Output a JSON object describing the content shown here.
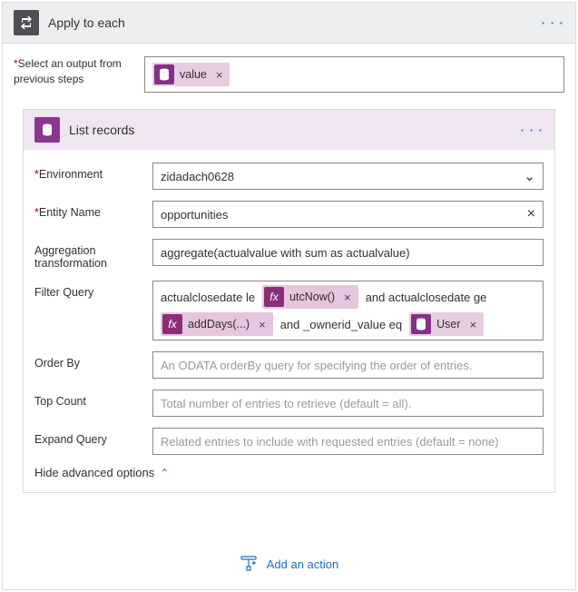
{
  "outer": {
    "title": "Apply to each",
    "label_html": "Select an output from previous steps",
    "value_chip": "value"
  },
  "inner": {
    "title": "List records",
    "environment": {
      "label": "Environment",
      "value": "zidadach0628"
    },
    "entity": {
      "label": "Entity Name",
      "value": "opportunities"
    },
    "aggregation": {
      "label": "Aggregation transformation",
      "value": "aggregate(actualvalue with sum as actualvalue)"
    },
    "filter": {
      "label": "Filter Query",
      "text1": "actualclosedate le",
      "chip1": "utcNow()",
      "text2": "and actualclosedate ge",
      "chip2": "addDays(...)",
      "text3": "and _ownerid_value eq",
      "chip3": "User"
    },
    "orderby": {
      "label": "Order By",
      "placeholder": "An ODATA orderBy query for specifying the order of entries."
    },
    "topcount": {
      "label": "Top Count",
      "placeholder": "Total number of entries to retrieve (default = all)."
    },
    "expand": {
      "label": "Expand Query",
      "placeholder": "Related entries to include with requested entries (default = none)"
    },
    "hide": "Hide advanced options"
  },
  "add_action": "Add an action"
}
